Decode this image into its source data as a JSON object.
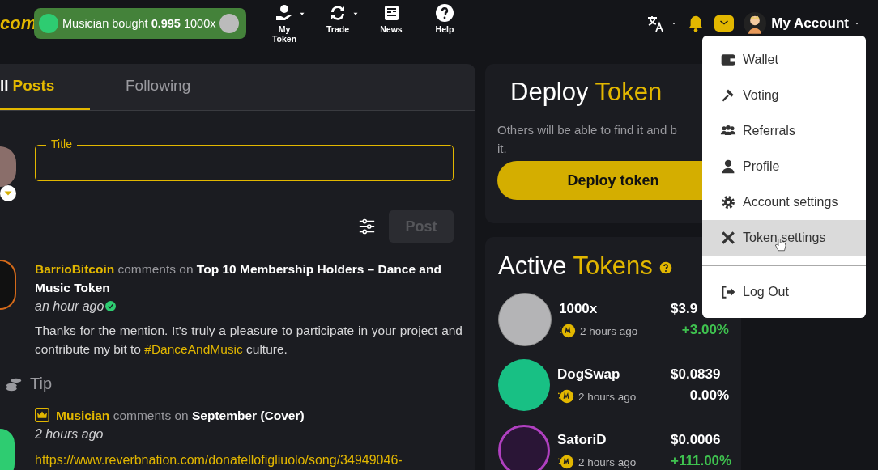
{
  "header": {
    "logo": "com",
    "ticker": {
      "text": "Musician bought",
      "amount": "0.995",
      "token": "1000x"
    },
    "nav": [
      {
        "label": "My Token",
        "caret": true
      },
      {
        "label": "Trade",
        "caret": true
      },
      {
        "label": "News",
        "caret": false
      },
      {
        "label": "Help",
        "caret": false
      }
    ],
    "account": "My Account"
  },
  "feed": {
    "tabs": [
      {
        "parts": [
          "ll",
          "Posts"
        ],
        "selected": true
      },
      {
        "parts": [
          "Following"
        ],
        "selected": false
      }
    ],
    "composer": {
      "field_label": "Title",
      "post_button": "Post",
      "post_disabled": true
    },
    "posts": [
      {
        "author": "BarrioBitcoin",
        "crown": false,
        "verb": "comments on",
        "title": "Top 10 Membership Holders – Dance and Music Token",
        "time": "an hour ago",
        "verified": true,
        "body": [
          {
            "kind": "text",
            "text": "Thanks for the mention. It's truly a pleasure to participate in your project and contribute my bit to "
          },
          {
            "kind": "hashtag",
            "text": "#DanceAndMusic"
          },
          {
            "kind": "text",
            "text": " culture."
          }
        ],
        "tip": "Tip"
      },
      {
        "author": "Musician",
        "crown": true,
        "verb": "comments on",
        "title": "September (Cover)",
        "time": "2 hours ago",
        "verified": false,
        "body": [
          {
            "kind": "link",
            "text": "https://www.reverbnation.com/donatellofigliuolo/song/34949046-"
          }
        ]
      }
    ]
  },
  "deploy": {
    "title": [
      "Deploy",
      "Token"
    ],
    "lines": [
      "Others will be able to find it and b",
      "it."
    ],
    "button": "Deploy token"
  },
  "active_tokens": {
    "title": [
      "Active",
      "Tokens"
    ],
    "tokens": [
      {
        "name": "1000x",
        "time": "2 hours ago",
        "price": "$3.9",
        "change": "+3.00%",
        "positive": true
      },
      {
        "name": "DogSwap",
        "time": "2 hours ago",
        "price": "$0.0839",
        "change": "0.00%",
        "positive": false
      },
      {
        "name": "SatoriD",
        "time": "2 hours ago",
        "price": "$0.0006",
        "change": "+111.00%",
        "positive": true
      }
    ]
  },
  "account_menu": {
    "items": [
      {
        "label": "Wallet",
        "selected": false
      },
      {
        "label": "Voting",
        "selected": false
      },
      {
        "label": "Referrals",
        "selected": false
      },
      {
        "label": "Profile",
        "selected": false
      },
      {
        "label": "Account settings",
        "selected": false
      },
      {
        "label": "Token settings",
        "selected": true
      }
    ],
    "footer_item": "Log Out"
  }
}
